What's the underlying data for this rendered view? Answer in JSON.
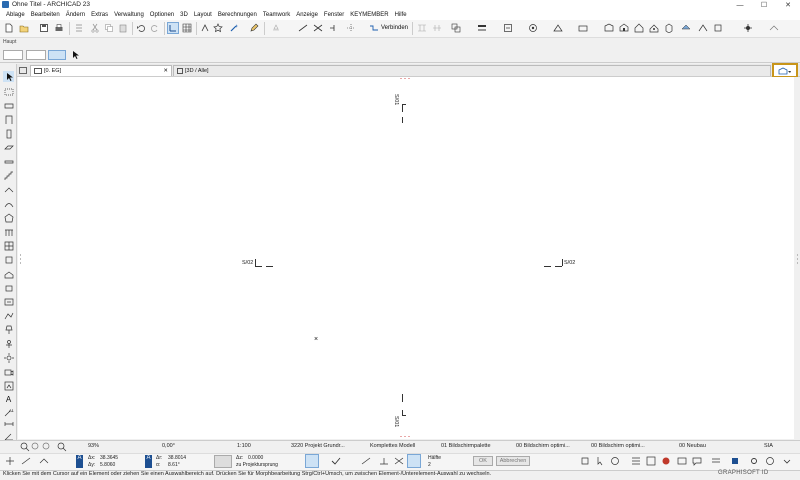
{
  "window": {
    "title": "Ohne Titel - ARCHICAD 23",
    "min": "—",
    "max": "☐",
    "close": "✕"
  },
  "menu": [
    "Ablage",
    "Bearbeiten",
    "Ändern",
    "Extras",
    "Verwaltung",
    "Optionen",
    "3D",
    "Layout",
    "Berechnungen",
    "Teamwork",
    "Anzeige",
    "Fenster",
    "KEYMEMBER",
    "Hilfe"
  ],
  "toolbar": {
    "connect_label": "Verbinden",
    "section_label": "Haupt"
  },
  "tabs": [
    {
      "label": "[0. EG]",
      "close": "✕"
    },
    {
      "label": "[3D / Alle]"
    }
  ],
  "canvas": {
    "markers": {
      "top": "S/01",
      "bottom": "S/01",
      "left": "S/02",
      "right": "S/02"
    },
    "origin": "×"
  },
  "statusbar": {
    "zoom": "93%",
    "angle": "0,00°",
    "scale": "1:100",
    "layer_combo": "3220 Projekt Grundr...",
    "model_view": "Komplettes Modell",
    "pen_set": "01 Bildschirmpalette",
    "graphic_override": "00 Bildschirm optimi...",
    "graphic_override2": "00 Bildschirm optimi...",
    "renovation": "00 Neubau",
    "dim_standard": "SIA"
  },
  "infobar": {
    "dx_label": "Δx:",
    "dx": "38.3645",
    "dy_label": "Δy:",
    "dy": "5.8060",
    "dr_label": "Δr:",
    "dr": "38.8014",
    "da_label": "α:",
    "da": "8.61°",
    "dz_label": "Δz:",
    "dz": "0.0000",
    "ref": "zu Projektursprung",
    "snap": "Hälfte",
    "snap_val": "2",
    "ok": "OK",
    "cancel": "Abbrechen"
  },
  "hint": "Klicken Sie mit dem Cursor auf ein Element oder ziehen Sie einen Auswahlbereich auf. Drücken Sie für Morphbearbeitung Strg/Ctrl+Umsch, um zwischen Element-/Unterelement-Auswahl zu wechseln.",
  "brand": "GRAPHISOFT ID"
}
